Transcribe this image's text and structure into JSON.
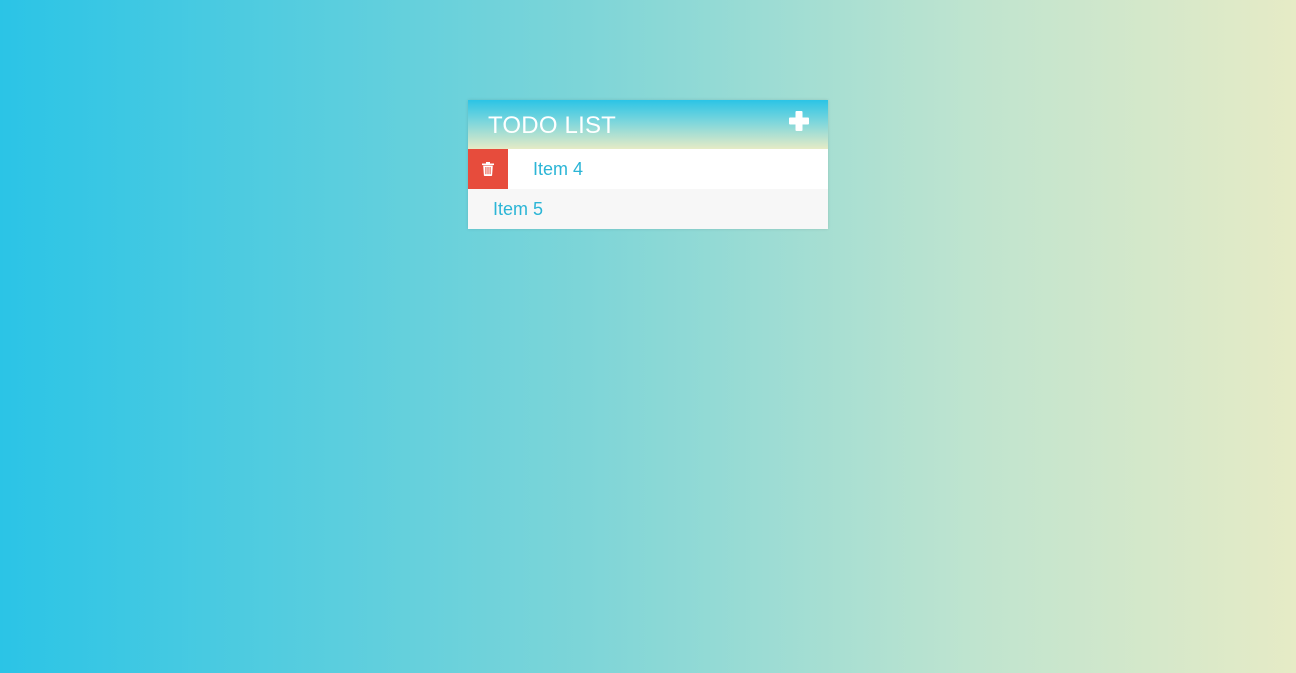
{
  "todo": {
    "title": "TODO LIST",
    "add_icon": "plus-icon",
    "delete_icon": "trash-icon",
    "items": [
      {
        "label": "Item 4",
        "state": "hover-delete-revealed"
      },
      {
        "label": "Item 5",
        "state": "default"
      }
    ]
  },
  "colors": {
    "accent_text": "#2bb5d6",
    "delete_red": "#e74c3c",
    "gradient_start": "#2bc4e6",
    "gradient_end": "#e6ebc6"
  }
}
